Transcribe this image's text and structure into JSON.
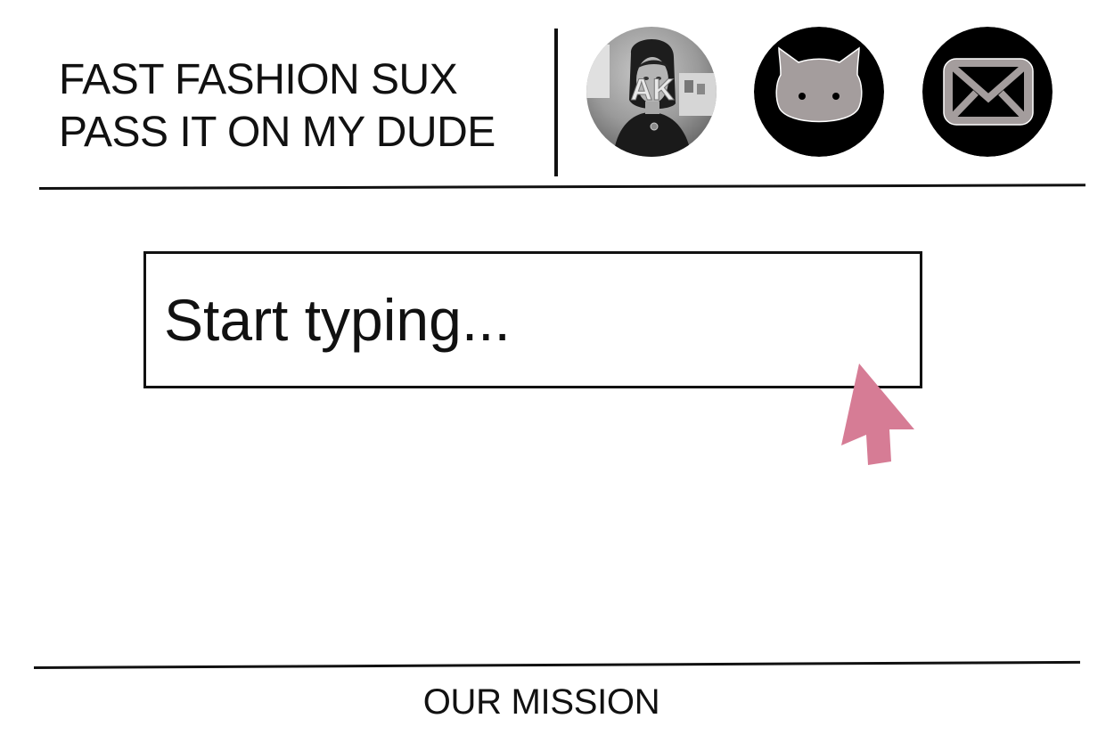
{
  "header": {
    "title_line1": "FAST FASHION SUX",
    "title_line2": "PASS IT ON MY DUDE",
    "avatar": {
      "initials": "AK"
    },
    "icons": {
      "cat": "cat-icon",
      "mail": "envelope-icon"
    }
  },
  "search": {
    "placeholder": "Start typing..."
  },
  "footer": {
    "mission_label": "OUR MISSION"
  },
  "colors": {
    "icon_background": "#000000",
    "icon_foreground": "#a49d9d",
    "cursor_accent": "#d67c95",
    "text": "#111111"
  }
}
